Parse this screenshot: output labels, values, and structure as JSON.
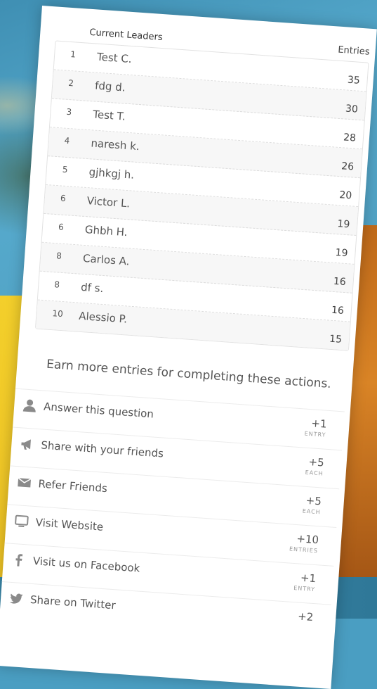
{
  "leaderboard": {
    "title": "Current Leaders",
    "entries_header": "Entries",
    "rows": [
      {
        "rank": "1",
        "name": "Test C.",
        "entries": "35"
      },
      {
        "rank": "2",
        "name": "fdg d.",
        "entries": "30"
      },
      {
        "rank": "3",
        "name": "Test T.",
        "entries": "28"
      },
      {
        "rank": "4",
        "name": "naresh k.",
        "entries": "26"
      },
      {
        "rank": "5",
        "name": "gjhkgj h.",
        "entries": "20"
      },
      {
        "rank": "6",
        "name": "Victor L.",
        "entries": "19"
      },
      {
        "rank": "6",
        "name": "Ghbh H.",
        "entries": "19"
      },
      {
        "rank": "8",
        "name": "Carlos A.",
        "entries": "16"
      },
      {
        "rank": "8",
        "name": "df s.",
        "entries": "16"
      },
      {
        "rank": "10",
        "name": "Alessio P.",
        "entries": "15"
      }
    ]
  },
  "earn_heading": "Earn more entries for completing these actions.",
  "actions": [
    {
      "icon": "user-icon",
      "label": "Answer this question",
      "points": "+1",
      "unit": "ENTRY"
    },
    {
      "icon": "megaphone-icon",
      "label": "Share with your friends",
      "points": "+5",
      "unit": "EACH"
    },
    {
      "icon": "envelope-icon",
      "label": "Refer Friends",
      "points": "+5",
      "unit": "EACH"
    },
    {
      "icon": "monitor-icon",
      "label": "Visit Website",
      "points": "+10",
      "unit": "ENTRIES"
    },
    {
      "icon": "facebook-icon",
      "label": "Visit us on Facebook",
      "points": "+1",
      "unit": "ENTRY"
    },
    {
      "icon": "twitter-icon",
      "label": "Share on Twitter",
      "points": "+2",
      "unit": ""
    }
  ]
}
